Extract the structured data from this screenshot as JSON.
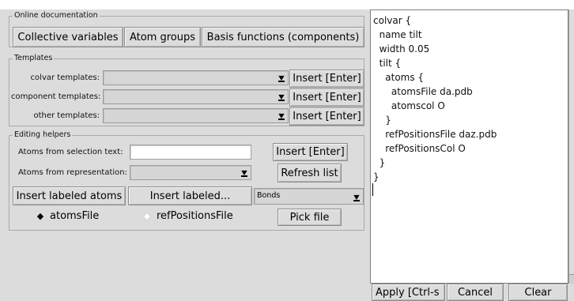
{
  "online_docs": {
    "title": "Online documentation",
    "buttons": [
      "Collective variables",
      "Atom groups",
      "Basis functions (components)"
    ]
  },
  "templates": {
    "title": "Templates",
    "rows": [
      {
        "label": "colvar templates:",
        "button": "Insert [Enter]"
      },
      {
        "label": "component templates:",
        "button": "Insert [Enter]"
      },
      {
        "label": "other templates:",
        "button": "Insert [Enter]"
      }
    ]
  },
  "editing": {
    "title": "Editing helpers",
    "selection_label": "Atoms from selection text:",
    "selection_value": "",
    "selection_button": "Insert [Enter]",
    "representation_label": "Atoms from representation:",
    "refresh_button": "Refresh list",
    "insert_labeled_atoms": "Insert labeled atoms",
    "insert_labeled": "Insert labeled...",
    "label_type": "Bonds",
    "radio_atomsfile": "atomsFile",
    "radio_refpositions": "refPositionsFile",
    "pick_file": "Pick file"
  },
  "editor": {
    "lines": [
      "colvar {",
      "  name tilt",
      "  width 0.05",
      "  tilt {",
      "    atoms {",
      "      atomsFile da.pdb",
      "      atomscol O",
      "    }",
      "    refPositionsFile daz.pdb",
      "    refPositionsCol O",
      "  }",
      "}"
    ]
  },
  "bottom_buttons": {
    "apply": "Apply [Ctrl-s",
    "cancel": "Cancel",
    "clear": "Clear"
  }
}
